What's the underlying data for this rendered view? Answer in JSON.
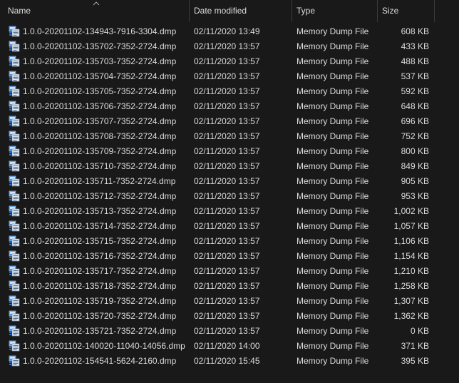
{
  "columns": {
    "name": "Name",
    "date": "Date modified",
    "type": "Type",
    "size": "Size",
    "sort_icon": "chevron-up-icon"
  },
  "file_icon": "memory-dump-file-icon",
  "files": [
    {
      "name": "1.0.0-20201102-134943-7916-3304.dmp",
      "date": "02/11/2020 13:49",
      "type": "Memory Dump File",
      "size": "608 KB"
    },
    {
      "name": "1.0.0-20201102-135702-7352-2724.dmp",
      "date": "02/11/2020 13:57",
      "type": "Memory Dump File",
      "size": "433 KB"
    },
    {
      "name": "1.0.0-20201102-135703-7352-2724.dmp",
      "date": "02/11/2020 13:57",
      "type": "Memory Dump File",
      "size": "488 KB"
    },
    {
      "name": "1.0.0-20201102-135704-7352-2724.dmp",
      "date": "02/11/2020 13:57",
      "type": "Memory Dump File",
      "size": "537 KB"
    },
    {
      "name": "1.0.0-20201102-135705-7352-2724.dmp",
      "date": "02/11/2020 13:57",
      "type": "Memory Dump File",
      "size": "592 KB"
    },
    {
      "name": "1.0.0-20201102-135706-7352-2724.dmp",
      "date": "02/11/2020 13:57",
      "type": "Memory Dump File",
      "size": "648 KB"
    },
    {
      "name": "1.0.0-20201102-135707-7352-2724.dmp",
      "date": "02/11/2020 13:57",
      "type": "Memory Dump File",
      "size": "696 KB"
    },
    {
      "name": "1.0.0-20201102-135708-7352-2724.dmp",
      "date": "02/11/2020 13:57",
      "type": "Memory Dump File",
      "size": "752 KB"
    },
    {
      "name": "1.0.0-20201102-135709-7352-2724.dmp",
      "date": "02/11/2020 13:57",
      "type": "Memory Dump File",
      "size": "800 KB"
    },
    {
      "name": "1.0.0-20201102-135710-7352-2724.dmp",
      "date": "02/11/2020 13:57",
      "type": "Memory Dump File",
      "size": "849 KB"
    },
    {
      "name": "1.0.0-20201102-135711-7352-2724.dmp",
      "date": "02/11/2020 13:57",
      "type": "Memory Dump File",
      "size": "905 KB"
    },
    {
      "name": "1.0.0-20201102-135712-7352-2724.dmp",
      "date": "02/11/2020 13:57",
      "type": "Memory Dump File",
      "size": "953 KB"
    },
    {
      "name": "1.0.0-20201102-135713-7352-2724.dmp",
      "date": "02/11/2020 13:57",
      "type": "Memory Dump File",
      "size": "1,002 KB"
    },
    {
      "name": "1.0.0-20201102-135714-7352-2724.dmp",
      "date": "02/11/2020 13:57",
      "type": "Memory Dump File",
      "size": "1,057 KB"
    },
    {
      "name": "1.0.0-20201102-135715-7352-2724.dmp",
      "date": "02/11/2020 13:57",
      "type": "Memory Dump File",
      "size": "1,106 KB"
    },
    {
      "name": "1.0.0-20201102-135716-7352-2724.dmp",
      "date": "02/11/2020 13:57",
      "type": "Memory Dump File",
      "size": "1,154 KB"
    },
    {
      "name": "1.0.0-20201102-135717-7352-2724.dmp",
      "date": "02/11/2020 13:57",
      "type": "Memory Dump File",
      "size": "1,210 KB"
    },
    {
      "name": "1.0.0-20201102-135718-7352-2724.dmp",
      "date": "02/11/2020 13:57",
      "type": "Memory Dump File",
      "size": "1,258 KB"
    },
    {
      "name": "1.0.0-20201102-135719-7352-2724.dmp",
      "date": "02/11/2020 13:57",
      "type": "Memory Dump File",
      "size": "1,307 KB"
    },
    {
      "name": "1.0.0-20201102-135720-7352-2724.dmp",
      "date": "02/11/2020 13:57",
      "type": "Memory Dump File",
      "size": "1,362 KB"
    },
    {
      "name": "1.0.0-20201102-135721-7352-2724.dmp",
      "date": "02/11/2020 13:57",
      "type": "Memory Dump File",
      "size": "0 KB"
    },
    {
      "name": "1.0.0-20201102-140020-11040-14056.dmp",
      "date": "02/11/2020 14:00",
      "type": "Memory Dump File",
      "size": "371 KB"
    },
    {
      "name": "1.0.0-20201102-154541-5624-2160.dmp",
      "date": "02/11/2020 15:45",
      "type": "Memory Dump File",
      "size": "395 KB"
    }
  ]
}
